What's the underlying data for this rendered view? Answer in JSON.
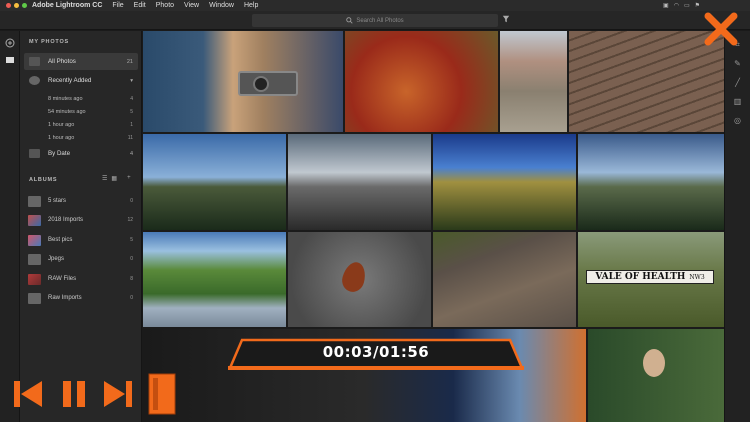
{
  "menubar": {
    "app_name": "Adobe Lightroom CC",
    "menus": [
      "File",
      "Edit",
      "Photo",
      "View",
      "Window",
      "Help"
    ]
  },
  "toolbar": {
    "search_placeholder": "Search All Photos"
  },
  "sidebar": {
    "my_photos_title": "MY PHOTOS",
    "all_photos": {
      "label": "All Photos",
      "count": "21"
    },
    "recently_added": {
      "label": "Recently Added"
    },
    "recent_items": [
      {
        "label": "8 minutes ago",
        "count": "4"
      },
      {
        "label": "54 minutes ago",
        "count": "5"
      },
      {
        "label": "1 hour ago",
        "count": "1"
      },
      {
        "label": "1 hour ago",
        "count": "11"
      }
    ],
    "by_date": {
      "label": "By Date",
      "count": "4"
    },
    "albums_title": "ALBUMS",
    "albums": [
      {
        "label": "5 stars",
        "count": "0",
        "color": "#666666"
      },
      {
        "label": "2018 Imports",
        "count": "12",
        "color": "#c0504d"
      },
      {
        "label": "Best pics",
        "count": "5",
        "color": "#d0576a"
      },
      {
        "label": "Jpegs",
        "count": "0",
        "color": "#666666"
      },
      {
        "label": "RAW Files",
        "count": "8",
        "color": "#b03a3a"
      },
      {
        "label": "Raw Imports",
        "count": "0",
        "color": "#666666"
      }
    ]
  },
  "photos": [
    {
      "name": "camera-hands",
      "colors": [
        "#2a4a6a",
        "#c9a27a",
        "#6a4a3a"
      ]
    },
    {
      "name": "red-ivy",
      "colors": [
        "#9a2a1a",
        "#c8642a",
        "#6a8a2a"
      ]
    },
    {
      "name": "cobblestone-street",
      "colors": [
        "#8a8070",
        "#c8c0b0",
        "#5a4a3a"
      ]
    },
    {
      "name": "wooden-deck",
      "colors": [
        "#7a6050",
        "#a08068",
        "#4a3a30"
      ]
    },
    {
      "name": "forest-ridge-1",
      "colors": [
        "#3a6aa8",
        "#8ab0d8",
        "#2a3a2a"
      ]
    },
    {
      "name": "forest-ridge-2",
      "colors": [
        "#6a7a8a",
        "#c0c8d0",
        "#3a3a3a"
      ]
    },
    {
      "name": "forest-ridge-3",
      "colors": [
        "#1a3a8a",
        "#4a80d0",
        "#3a4a1a"
      ]
    },
    {
      "name": "forest-ridge-4",
      "colors": [
        "#3a5a8a",
        "#9ab8d8",
        "#2a3a2a"
      ]
    },
    {
      "name": "river-mountains",
      "colors": [
        "#4a7ab8",
        "#9ac0e0",
        "#5a8a3a"
      ]
    },
    {
      "name": "autumn-leaf",
      "colors": [
        "#5a5a5a",
        "#7a7a7a",
        "#8a3a1a"
      ]
    },
    {
      "name": "dirt-path",
      "colors": [
        "#5a5048",
        "#7a6a5a",
        "#4a5a2a"
      ]
    },
    {
      "name": "vale-of-health",
      "colors": [
        "#6a7a4a",
        "#8a9a6a",
        "#3a3a3a"
      ]
    },
    {
      "name": "sunset-sky",
      "colors": [
        "#1a2a4a",
        "#6a8ab0",
        "#d07030"
      ]
    },
    {
      "name": "portrait-ivy",
      "colors": [
        "#2a4a2a",
        "#4a6a3a",
        "#d0b090"
      ]
    }
  ],
  "sign_text": "VALE OF HEALTH",
  "sign_sub": "NW3",
  "video": {
    "timecode": "00:03/01:56",
    "accent": "#f26a1b"
  }
}
